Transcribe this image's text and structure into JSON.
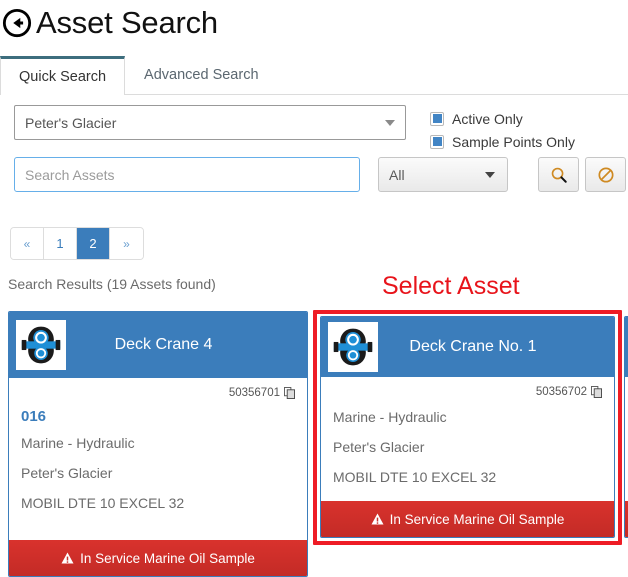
{
  "header": {
    "back_icon": "circle-arrow-left-icon",
    "title": "Asset Search"
  },
  "tabs": [
    {
      "label": "Quick Search",
      "active": true
    },
    {
      "label": "Advanced Search",
      "active": false
    }
  ],
  "search": {
    "site_select": {
      "value": "Peter's Glacier",
      "caret_icon": "chevron-down-icon"
    },
    "checkboxes": [
      {
        "label": "Active Only",
        "checked": true
      },
      {
        "label": "Sample Points Only",
        "checked": true
      }
    ],
    "assets_input": {
      "value": "",
      "placeholder": "Search Assets"
    },
    "type_select": {
      "value": "All",
      "caret_icon": "chevron-down-icon"
    },
    "search_button": {
      "icon": "search-icon",
      "color": "#d98c22"
    },
    "clear_button": {
      "icon": "ban-icon",
      "color": "#d98c22"
    }
  },
  "pagination": {
    "prev_label": "«",
    "next_label": "»",
    "pages": [
      "1",
      "2"
    ],
    "active_page": "2"
  },
  "results_label": "Search Results (19 Assets found)",
  "annotation": {
    "text": "Select Asset",
    "color": "#e8141b",
    "highlight_color": "#ee1c25"
  },
  "colors": {
    "card_header_blue": "#3b7dbb",
    "card_border_blue": "#3b7dbb",
    "footer_red": "#c9302c",
    "tab_accent": "#3d6e7e",
    "checkbox_blue": "#4285c5"
  },
  "cards": [
    {
      "thumb_icon": "gearbox-asset-icon",
      "title": "Deck Crane 4",
      "asset_id": "50356701",
      "copy_icon": "copy-icon",
      "code": "016",
      "details": [
        "Marine - Hydraulic",
        "Peter's Glacier",
        "MOBIL DTE 10 EXCEL 32"
      ],
      "footer": {
        "icon": "warning-triangle-icon",
        "label": "In Service Marine Oil Sample"
      },
      "selected": false
    },
    {
      "thumb_icon": "gearbox-asset-icon",
      "title": "Deck Crane No. 1",
      "asset_id": "50356702",
      "copy_icon": "copy-icon",
      "code": "",
      "details": [
        "Marine - Hydraulic",
        "Peter's Glacier",
        "MOBIL DTE 10 EXCEL 32"
      ],
      "footer": {
        "icon": "warning-triangle-icon",
        "label": "In Service Marine Oil Sample"
      },
      "selected": true
    },
    {
      "thumb_icon": "gearbox-asset-icon",
      "title": "",
      "asset_id": "",
      "copy_icon": "copy-icon",
      "code": "",
      "details": [
        "",
        "",
        ""
      ],
      "footer": {
        "icon": "warning-triangle-icon",
        "label": ""
      },
      "selected": false
    }
  ]
}
